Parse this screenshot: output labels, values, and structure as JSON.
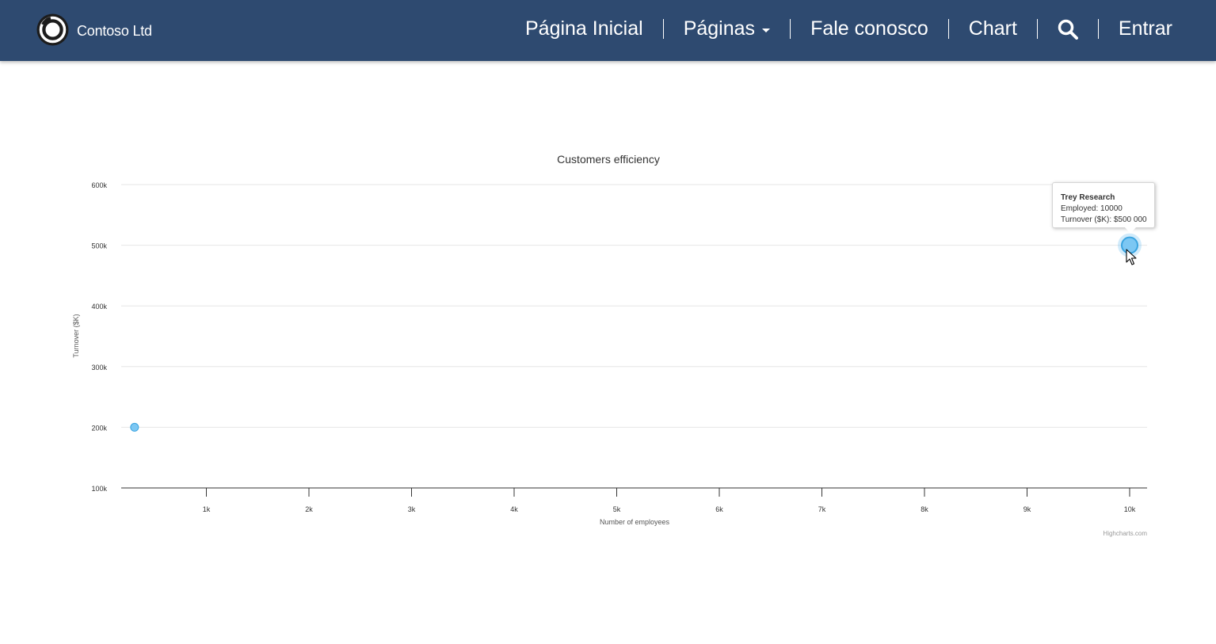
{
  "brand": {
    "name": "Contoso Ltd"
  },
  "nav": {
    "home": "Página Inicial",
    "pages": "Páginas",
    "contact": "Fale conosco",
    "chart": "Chart",
    "signin": "Entrar"
  },
  "colors": {
    "navbar": "#2e4a70",
    "point_fill": "#7cc7f3",
    "point_stroke": "#3aa4e0",
    "gridline": "#e6e6e6"
  },
  "chart_data": {
    "type": "scatter",
    "title": "Customers efficiency",
    "xlabel": "Number of employees",
    "ylabel": "Turnover ($K)",
    "xlim": [
      170,
      10170
    ],
    "ylim": [
      100000,
      600000
    ],
    "xticks": [
      {
        "value": 1000,
        "label": "1k"
      },
      {
        "value": 2000,
        "label": "2k"
      },
      {
        "value": 3000,
        "label": "3k"
      },
      {
        "value": 4000,
        "label": "4k"
      },
      {
        "value": 5000,
        "label": "5k"
      },
      {
        "value": 6000,
        "label": "6k"
      },
      {
        "value": 7000,
        "label": "7k"
      },
      {
        "value": 8000,
        "label": "8k"
      },
      {
        "value": 9000,
        "label": "9k"
      },
      {
        "value": 10000,
        "label": "10k"
      }
    ],
    "yticks": [
      {
        "value": 100000,
        "label": "100k"
      },
      {
        "value": 200000,
        "label": "200k"
      },
      {
        "value": 300000,
        "label": "300k"
      },
      {
        "value": 400000,
        "label": "400k"
      },
      {
        "value": 500000,
        "label": "500k"
      },
      {
        "value": 600000,
        "label": "600k"
      }
    ],
    "grid": true,
    "points": [
      {
        "x": 300,
        "y": 200000,
        "hovered": false
      },
      {
        "x": 10000,
        "y": 500000,
        "hovered": true
      }
    ],
    "credits": "Highcharts.com"
  },
  "tooltip": {
    "title": "Trey Research",
    "line1": "Employed: 10000",
    "line2": "Turnover ($K): $500 000"
  }
}
